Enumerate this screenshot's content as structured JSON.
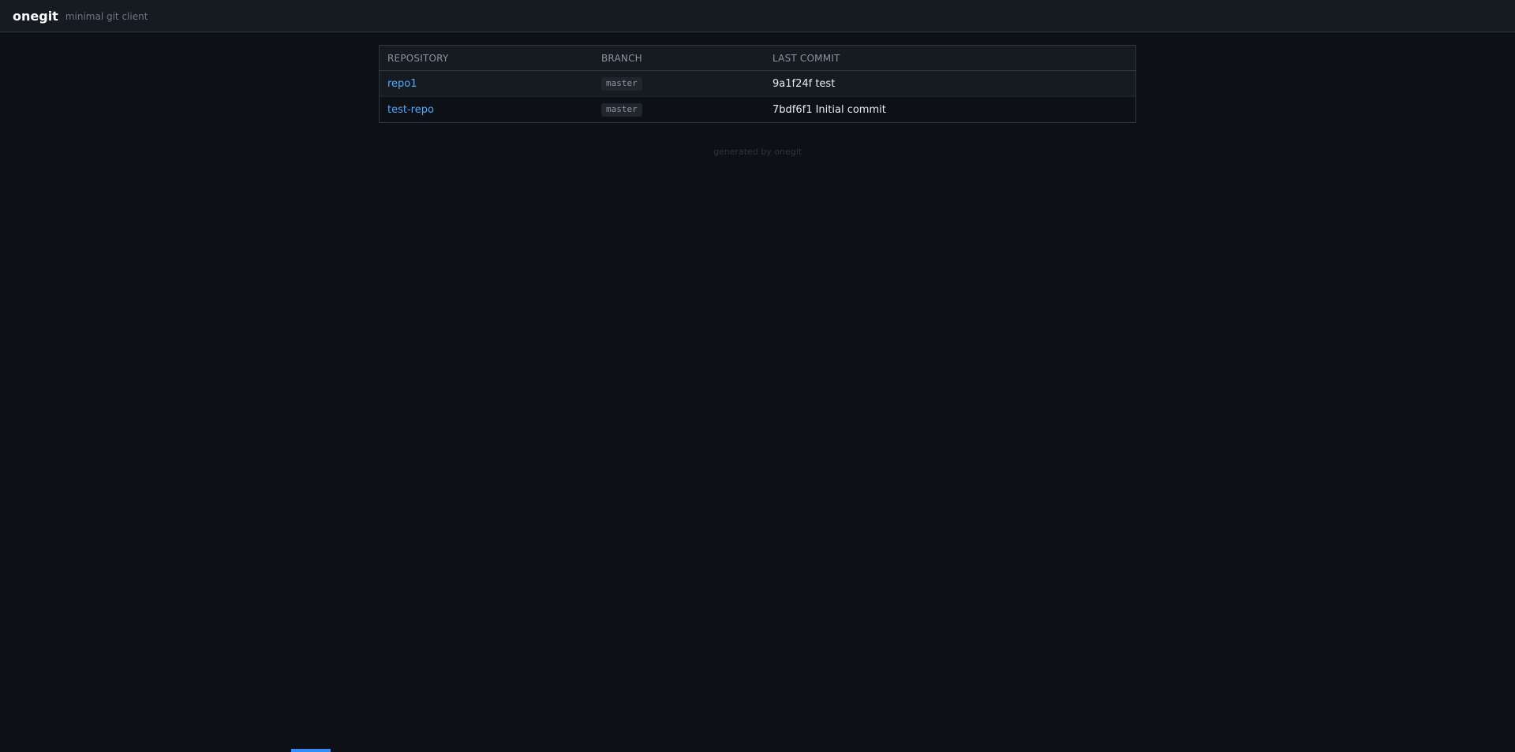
{
  "header": {
    "brand": "onegit",
    "tagline": "minimal git client"
  },
  "table": {
    "columns": [
      "REPOSITORY",
      "BRANCH",
      "LAST COMMIT"
    ],
    "rows": [
      {
        "repository": "repo1",
        "branch": "master",
        "last_commit": "9a1f24f test"
      },
      {
        "repository": "test-repo",
        "branch": "master",
        "last_commit": "7bdf6f1 Initial commit"
      }
    ]
  },
  "footer": {
    "text": "generated by onegit"
  },
  "colors": {
    "background": "#0d1117",
    "header_bg": "#161b22",
    "link": "#58a6ff",
    "accent": "#388bfd"
  }
}
